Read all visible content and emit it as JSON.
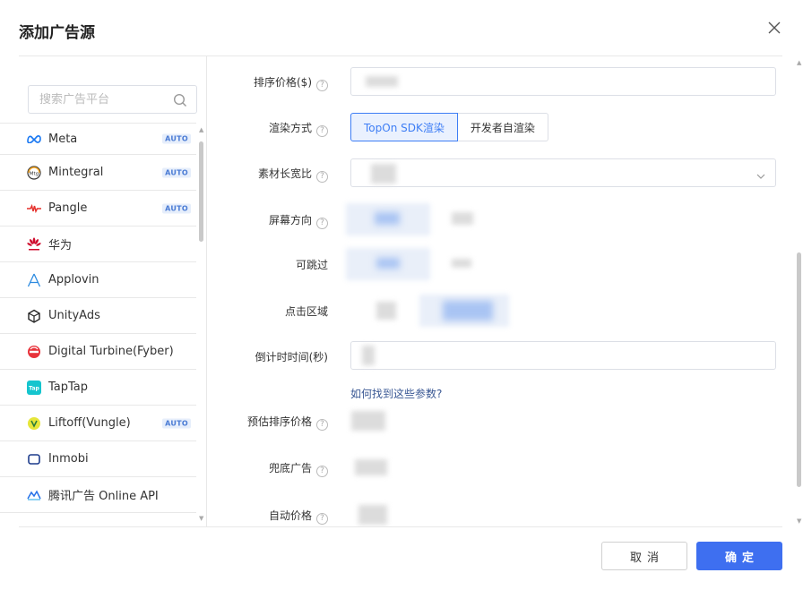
{
  "dialog": {
    "title": "添加广告源"
  },
  "search": {
    "placeholder": "搜索广告平台"
  },
  "platforms": [
    {
      "name": "Meta",
      "icon": "meta-icon",
      "badge": "AUTO"
    },
    {
      "name": "Mintegral",
      "icon": "mintegral-icon",
      "badge": "AUTO"
    },
    {
      "name": "Pangle",
      "icon": "pangle-icon",
      "badge": "AUTO"
    },
    {
      "name": "华为",
      "icon": "huawei-icon",
      "badge": ""
    },
    {
      "name": "Applovin",
      "icon": "applovin-icon",
      "badge": ""
    },
    {
      "name": "UnityAds",
      "icon": "unity-icon",
      "badge": ""
    },
    {
      "name": "Digital Turbine(Fyber)",
      "icon": "digital-turbine-icon",
      "badge": ""
    },
    {
      "name": "TapTap",
      "icon": "taptap-icon",
      "badge": ""
    },
    {
      "name": "Liftoff(Vungle)",
      "icon": "liftoff-icon",
      "badge": "AUTO"
    },
    {
      "name": "Inmobi",
      "icon": "inmobi-icon",
      "badge": ""
    },
    {
      "name": "腾讯广告 Online API",
      "icon": "tencent-icon",
      "badge": ""
    }
  ],
  "form": {
    "sort_price_label": "排序价格($)",
    "render_mode_label": "渲染方式",
    "render_options": [
      "TopOn SDK渲染",
      "开发者自渲染"
    ],
    "aspect_ratio_label": "素材长宽比",
    "orientation_label": "屏幕方向",
    "skippable_label": "可跳过",
    "click_area_label": "点击区域",
    "countdown_label": "倒计时时间(秒)",
    "help_link": "如何找到这些参数?",
    "estimated_price_label": "预估排序价格",
    "fallback_label": "兜底广告",
    "auto_price_label": "自动价格"
  },
  "footer": {
    "cancel": "取消",
    "ok": "确定"
  },
  "colors": {
    "primary": "#3e6ff0",
    "link": "#3a5894",
    "badge": "#4a7bd4"
  }
}
